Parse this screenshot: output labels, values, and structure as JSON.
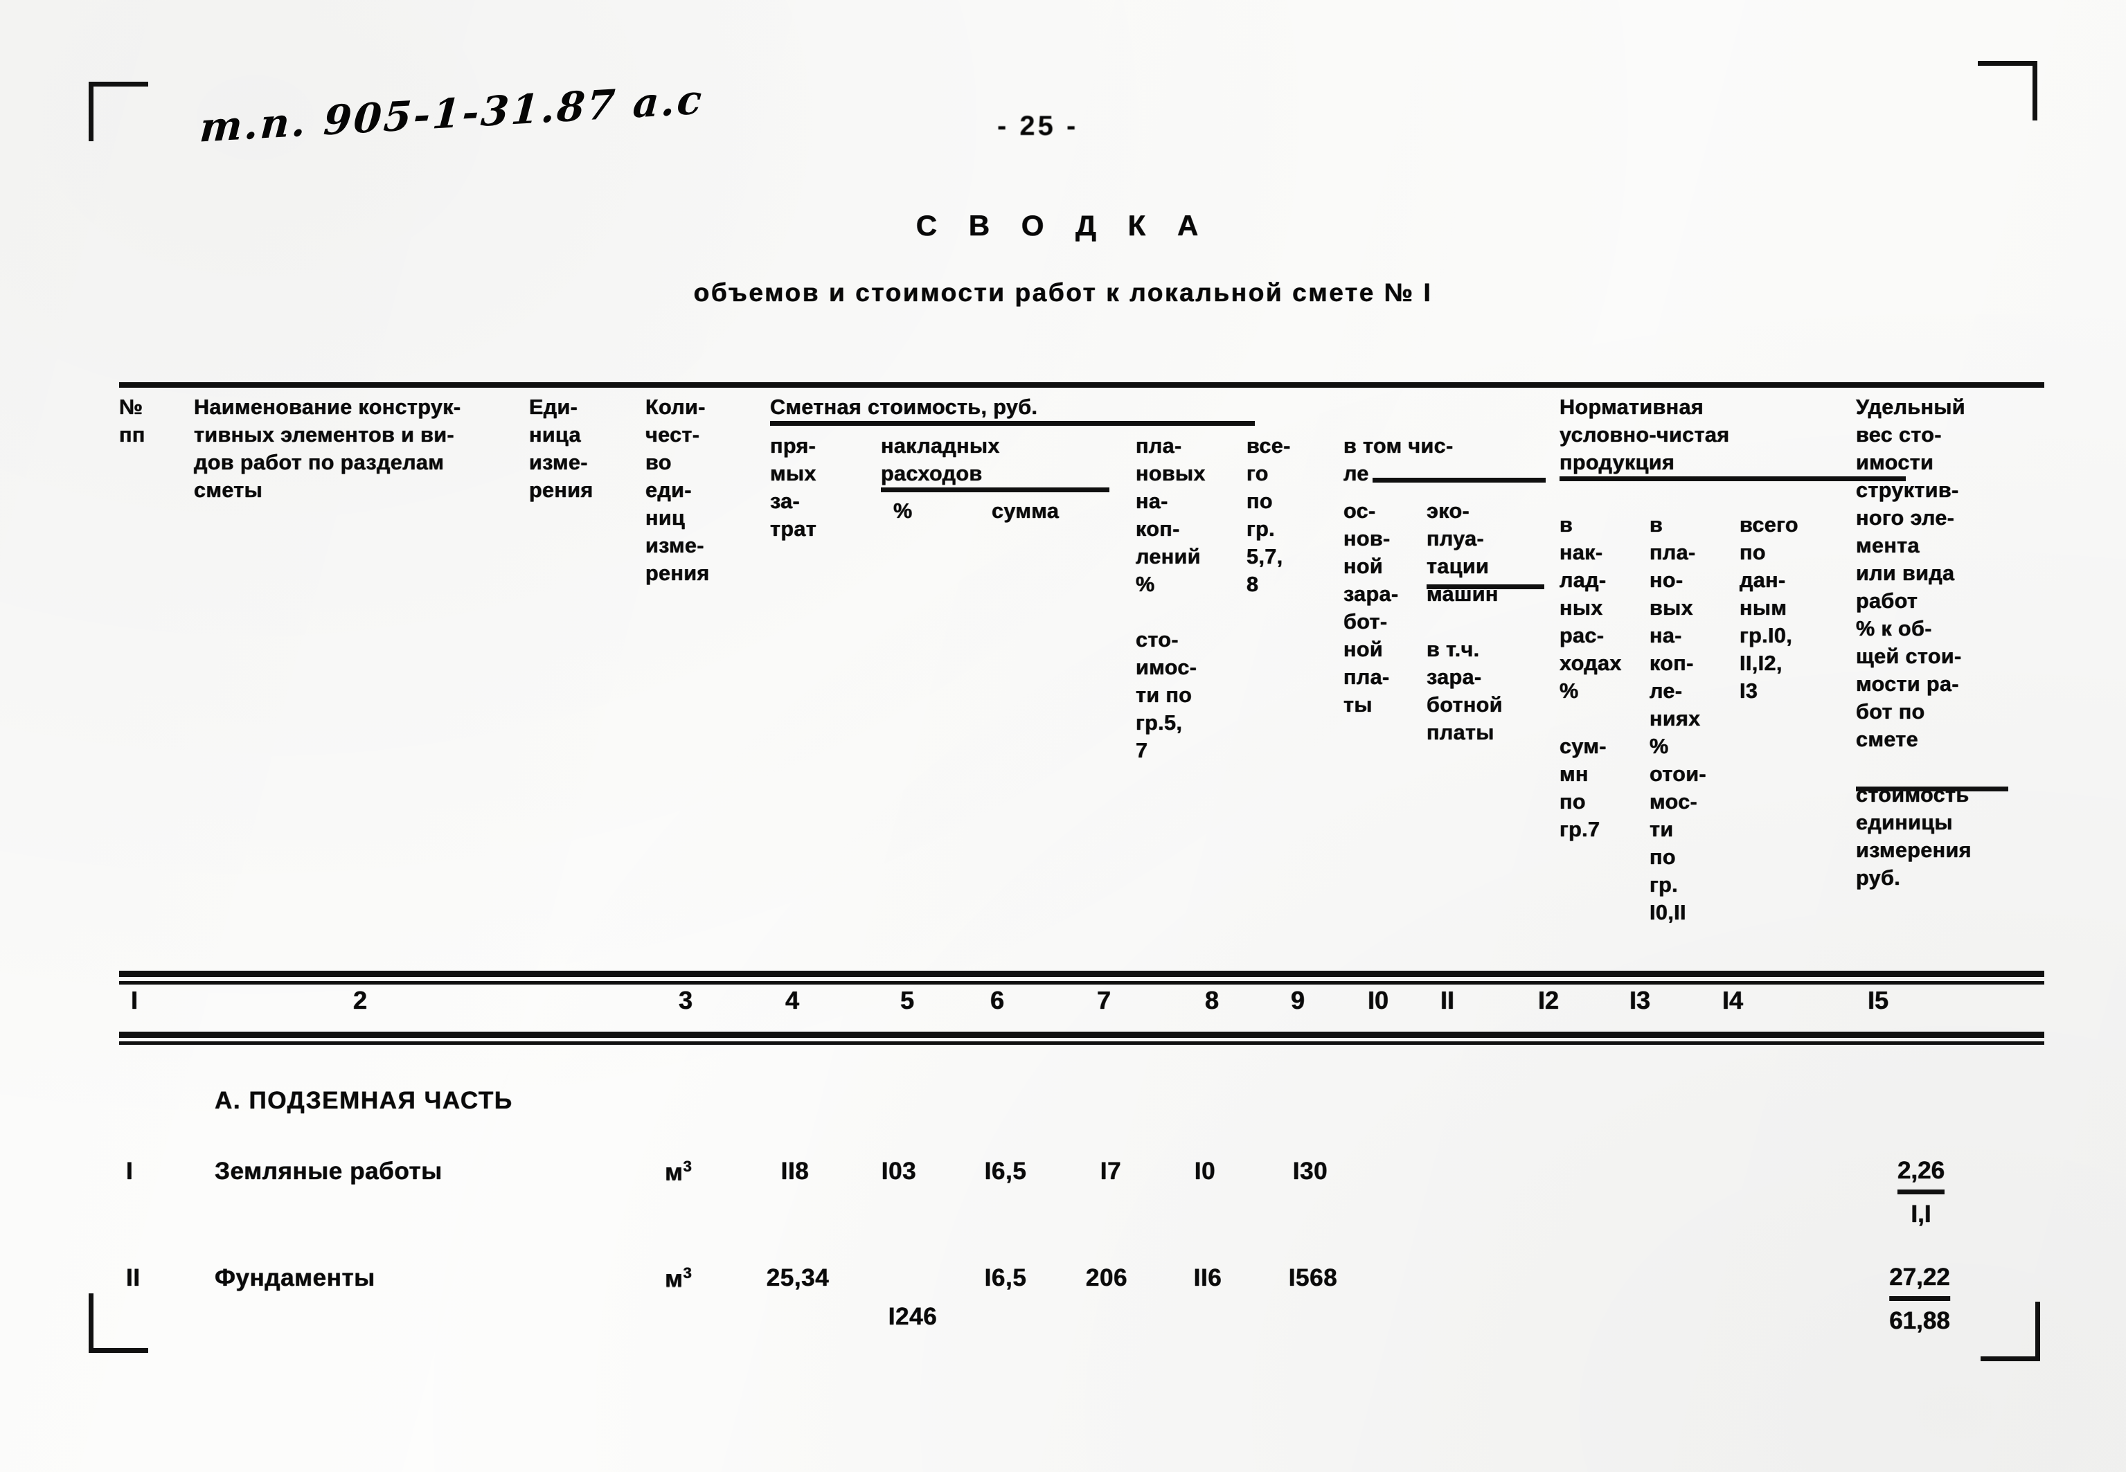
{
  "page": {
    "handwritten_reference": "т.п. 905-1-31.87 а.с",
    "page_number": "- 25 -"
  },
  "title": {
    "main": "С В О Д К А",
    "subtitle": "объемов и стоимости работ к локальной смете № I"
  },
  "table": {
    "group_headers": {
      "estimate_cost": "Сметная стоимость, руб.",
      "overheads": "накладных\nрасходов",
      "including": "в том чис-\nле",
      "normative_product": "Нормативная\nусловно-чистая\nпродукция"
    },
    "columns": [
      {
        "no": "I",
        "header": "№\nпп"
      },
      {
        "no": "2",
        "header": "Наименование конструк-\nтивных элементов и ви-\nдов работ по разделам\nсметы"
      },
      {
        "no": "3",
        "header": "Еди-\nница\nизме-\nрения"
      },
      {
        "no": "4",
        "header": "Коли-\nчест-\nво\nеди-\nниц\nизме-\nрения"
      },
      {
        "no": "5",
        "header": "пря-\nмых\nза-\nтрат"
      },
      {
        "no": "6",
        "header": "%"
      },
      {
        "no": "7",
        "header": "сумма"
      },
      {
        "no": "8",
        "header": "пла-\nновых\nна-\nкоп-\nлений\n%\n\nсто-\nимос-\nти по\nгр.5,\n7"
      },
      {
        "no": "9",
        "header": "все-\nго\nпо\nгр.\n5,7,\n8"
      },
      {
        "no": "I0",
        "header": "ос-\nнов-\nной\nзара-\nбот-\nной\nпла-\nты"
      },
      {
        "no": "II",
        "header": "эко-\nплуа-\nтации\nмашин\n\nв т.ч.\nзара-\nботной\nплаты"
      },
      {
        "no": "I2",
        "header": "в\nнак-\nлад-\nных\nрас-\nходах\n%\n\nсум-\nмн\nпо\nгр.7"
      },
      {
        "no": "I3",
        "header": "в\nпла-\nно-\nвых\nна-\nкоп-\nле-\nниях\n%\nотои-\nмос-\nти\nпо\nгр.\nI0,II"
      },
      {
        "no": "I4",
        "header": "всего\nпо\nдан-\nным\nгр.I0,\nII,I2,\nI3"
      },
      {
        "no": "I5",
        "header": "Удельный\nвес сто-\nимости\nструктив-\nного эле-\nмента\nили вида\nработ\n% к об-\nщей стои-\nмости ра-\nбот по\nсмете\n\nстоимость\nединицы\nизмерения\nруб."
      }
    ],
    "section": "А. ПОДЗЕМНАЯ ЧАСТЬ",
    "rows": [
      {
        "no": "I",
        "name": "Земляные работы",
        "unit": "м",
        "unit_sup": "3",
        "quantity": "II8",
        "direct": "I03",
        "overhead_pct": "I6,5",
        "overhead_sum": "I7",
        "planned_savings": "I0",
        "total": "I30",
        "direct_extra": "",
        "basic_wage": "",
        "machines": "",
        "ncp_overhead": "",
        "ncp_planned": "",
        "ncp_total": "",
        "share_numerator": "2,26",
        "share_denominator": "I,I"
      },
      {
        "no": "II",
        "name": "Фундаменты",
        "unit": "м",
        "unit_sup": "3",
        "quantity": "25,34",
        "direct": "I246",
        "overhead_pct": "I6,5",
        "overhead_sum": "206",
        "planned_savings": "II6",
        "total": "I568",
        "direct_extra": "",
        "basic_wage": "",
        "machines": "",
        "ncp_overhead": "",
        "ncp_planned": "",
        "ncp_total": "",
        "share_numerator": "27,22",
        "share_denominator": "61,88"
      }
    ]
  }
}
